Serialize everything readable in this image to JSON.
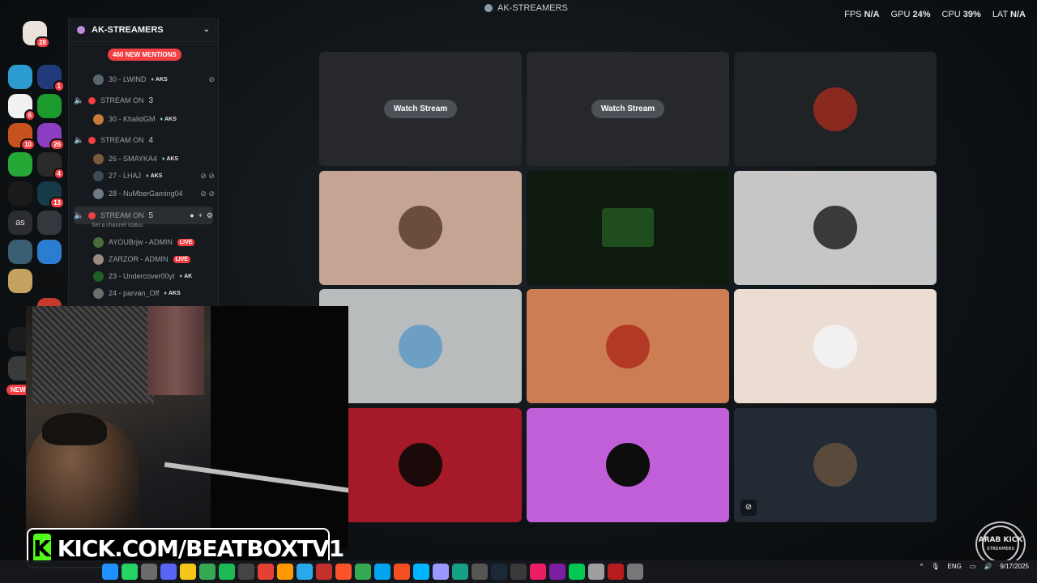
{
  "window": {
    "title": "AK-STREAMERS"
  },
  "stats": [
    {
      "label": "FPS",
      "value": "N/A"
    },
    {
      "label": "GPU",
      "value": "24%"
    },
    {
      "label": "CPU",
      "value": "39%"
    },
    {
      "label": "LAT",
      "value": "N/A"
    }
  ],
  "rail": {
    "servers": [
      {
        "name": "home",
        "color": "#e9e3dc",
        "badge": "28"
      },
      {
        "name": "server-1",
        "color": "#2b9bd1",
        "badge": ""
      },
      {
        "name": "server-2",
        "color": "#203a7a",
        "badge": "1"
      },
      {
        "name": "server-3",
        "color": "#f1f1f1",
        "badge": "6"
      },
      {
        "name": "server-4",
        "color": "#1c9a2e",
        "badge": ""
      },
      {
        "name": "server-5",
        "color": "#c6531d",
        "badge": "10"
      },
      {
        "name": "server-6",
        "color": "#8c3ec2",
        "badge": "26"
      },
      {
        "name": "server-7",
        "color": "#25a836",
        "badge": ""
      },
      {
        "name": "server-8",
        "color": "#2a2a2a",
        "badge": "4"
      },
      {
        "name": "server-9",
        "color": "#1a1a1a",
        "badge": ""
      },
      {
        "name": "server-10",
        "color": "#173a47",
        "badge": "13"
      },
      {
        "name": "server-11",
        "color": "#34373d",
        "badge": ""
      },
      {
        "name": "server-12",
        "color": "#3a5e72",
        "badge": ""
      },
      {
        "name": "server-13",
        "color": "#2c7dd1",
        "badge": ""
      },
      {
        "name": "server-14",
        "color": "#c4a25f",
        "badge": ""
      },
      {
        "name": "server-15",
        "color": "#0f0f0f",
        "badge": ""
      },
      {
        "name": "server-16",
        "color": "#c53a2a",
        "badge": "3"
      },
      {
        "name": "server-17",
        "color": "#1c1c1c",
        "badge": ""
      },
      {
        "name": "server-18",
        "color": "#3a3a3a",
        "badge": ""
      }
    ],
    "as_label": "as",
    "new_label": "NEW"
  },
  "channels": {
    "guild_name": "AK-STREAMERS",
    "mentions": "460 NEW MENTIONS",
    "voice": [
      {
        "label": "STREAM ON",
        "num": "3"
      },
      {
        "label": "STREAM ON",
        "num": "4"
      },
      {
        "label": "STREAM ON",
        "num": "5"
      }
    ],
    "channel_status": "Set a channel status",
    "members": [
      {
        "name": "30 - LWIND",
        "tag": "AKS"
      },
      {
        "name": "30 - KhalidGM",
        "tag": "AKS"
      },
      {
        "name": "26 - SMAYKA4",
        "tag": "AKS"
      },
      {
        "name": "27 - LHAJ",
        "tag": "AKS"
      },
      {
        "name": "28 - NuMberGaming04",
        "tag": ""
      },
      {
        "name": "AYOUBrjw - ADMIN",
        "live": "LIVE"
      },
      {
        "name": "ZARZOR - ADMIN",
        "live": "LIVE"
      },
      {
        "name": "23 - Undercover00yt",
        "tag": "AK"
      },
      {
        "name": "24 - parvan_Off",
        "tag": "AKS"
      }
    ]
  },
  "grid": {
    "watch_label": "Watch Stream",
    "tiles": [
      {
        "bg": "#26282b",
        "kind": "watch"
      },
      {
        "bg": "#26282b",
        "kind": "watch"
      },
      {
        "bg": "#202326",
        "kind": "avatar",
        "av": "#8a2a1f"
      },
      {
        "bg": "#c5a493",
        "kind": "avatar",
        "av": "#6b4d3c"
      },
      {
        "bg": "#0f1a0f",
        "kind": "square",
        "av": "#1f4d1e"
      },
      {
        "bg": "#c6c6c6",
        "kind": "avatar",
        "av": "#3a3a3a"
      },
      {
        "bg": "#b9bcbd",
        "kind": "avatar",
        "av": "#6d9fc4"
      },
      {
        "bg": "#cd7d53",
        "kind": "avatar",
        "av": "#b23a25"
      },
      {
        "bg": "#ecddd4",
        "kind": "avatar",
        "av": "#f1f1f1"
      },
      {
        "bg": "#a51a28",
        "kind": "avatar",
        "av": "#1a0a0a"
      },
      {
        "bg": "#c05fd8",
        "kind": "avatar",
        "av": "#0d0d0d"
      },
      {
        "bg": "#222a33",
        "kind": "avatar",
        "av": "#5a4a3c"
      }
    ]
  },
  "overlay": {
    "kick_url": "KICK.COM/BEATBOXTV1",
    "badge_text": "ARAB KICK STREAMERS"
  },
  "taskbar": {
    "lang": "ENG",
    "time": "9/17/2025"
  }
}
